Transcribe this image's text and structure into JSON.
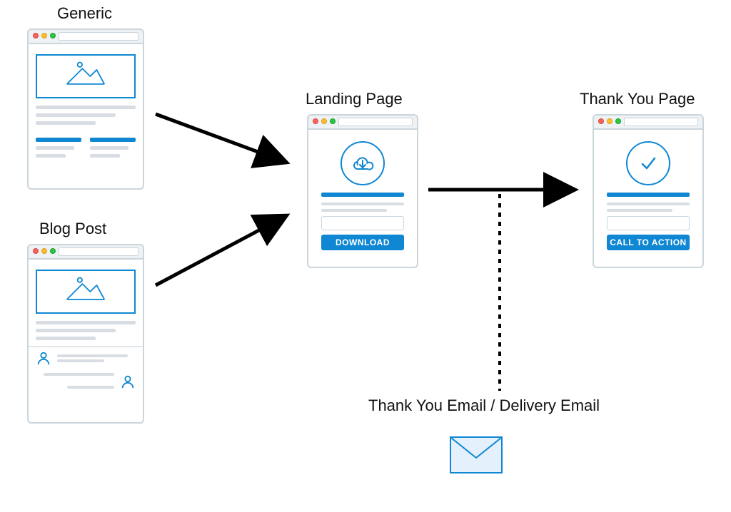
{
  "labels": {
    "generic": "Generic",
    "blog_post": "Blog Post",
    "landing_page": "Landing Page",
    "thank_you_page": "Thank You Page",
    "email": "Thank You Email / Delivery Email"
  },
  "landing_page": {
    "button": "DOWNLOAD"
  },
  "thank_you_page": {
    "button": "CALL TO ACTION"
  }
}
